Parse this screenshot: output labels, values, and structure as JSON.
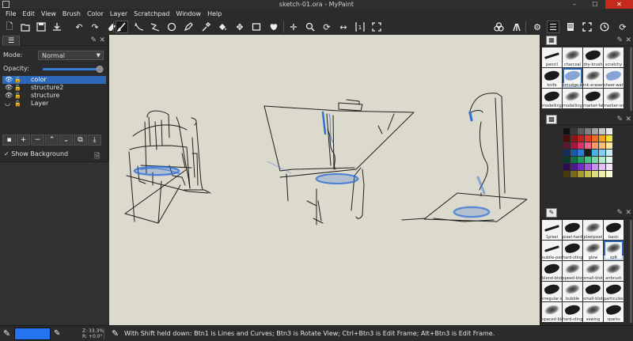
{
  "window": {
    "title": "sketch-01.ora - MyPaint",
    "minimize": "–",
    "maximize": "☐",
    "close": "✕"
  },
  "menu": [
    "File",
    "Edit",
    "View",
    "Brush",
    "Color",
    "Layer",
    "Scratchpad",
    "Window",
    "Help"
  ],
  "toolbar": {
    "icons": [
      "new-document-icon",
      "open-icon",
      "save-icon",
      "export-icon",
      "undo-icon",
      "redo-icon",
      "eraser-icon",
      "freehand-brush-icon",
      "lines-curves-icon",
      "connected-lines-icon",
      "ellipse-icon",
      "ink-pen-icon",
      "color-picker-icon",
      "fill-icon",
      "move-layer-icon",
      "frame-icon",
      "symmetry-icon",
      "pan-icon",
      "zoom-icon",
      "rotate-icon",
      "mirror-icon",
      "reset-view-icon",
      "fit-view-icon",
      "brush-settings-icon",
      "settings-gear-icon",
      "main-menu-icon",
      "scratchpad-icon",
      "fullscreen-icon",
      "history-icon",
      "more-icon"
    ]
  },
  "layers_panel": {
    "tab_icon": "layers-icon",
    "mode_label": "Mode:",
    "mode_value": "Normal",
    "opacity_label": "Opacity:",
    "opacity_value": 1.0,
    "layers": [
      {
        "name": "color",
        "selected": true
      },
      {
        "name": "structure2",
        "selected": false
      },
      {
        "name": "structure",
        "selected": false
      },
      {
        "name": "Layer",
        "selected": false
      }
    ],
    "buttons": [
      "layer-properties-icon",
      "add-layer-icon",
      "remove-layer-icon",
      "move-up-icon",
      "move-down-icon",
      "duplicate-layer-icon",
      "merge-down-icon"
    ],
    "show_background_label": "Show Background",
    "show_background_checked": true
  },
  "brush_group_1": {
    "brushes": [
      {
        "name": "pencil"
      },
      {
        "name": "charcoal"
      },
      {
        "name": "dry-brush"
      },
      {
        "name": "scratchy"
      },
      {
        "name": "knife"
      },
      {
        "name": "smudge-bleed"
      },
      {
        "name": "ink-eraser"
      },
      {
        "name": "sheer-watercolor"
      },
      {
        "name": "modelling"
      },
      {
        "name": "modelling2"
      },
      {
        "name": "marker-fat"
      },
      {
        "name": "marker-small"
      }
    ]
  },
  "palette": {
    "colors": [
      "#101010",
      "#3a3a3a",
      "#5d5d5d",
      "#808080",
      "#a3a3a3",
      "#c6c6c6",
      "#e9e9e9",
      "#4a0c0c",
      "#8a1a1a",
      "#c02222",
      "#e23b2a",
      "#f06d1e",
      "#f5a623",
      "#f7e23a",
      "#5a1a2e",
      "#a01a3c",
      "#e0306a",
      "#f06488",
      "#f79a6a",
      "#f6c07a",
      "#fbe89a",
      "#0f2e5a",
      "#1f5aa6",
      "#2d7be0",
      "#1c1c1c",
      "#4ab0e6",
      "#7fd0f2",
      "#c8ecfa",
      "#0c3a2a",
      "#16704a",
      "#22a063",
      "#46c085",
      "#7ad8a8",
      "#b2ecc8",
      "#e0f7ea",
      "#2a0c4a",
      "#4c1a8a",
      "#7a2ac6",
      "#a65ae0",
      "#c88ef0",
      "#e2bff6",
      "#f3e2fb",
      "#4a3a0c",
      "#7a6a1a",
      "#a69a2a",
      "#c6c04a",
      "#dcdc7a",
      "#ecf0a6",
      "#f9fbd6"
    ]
  },
  "brush_group_2": {
    "brushes": [
      {
        "name": "1pixel"
      },
      {
        "name": "pixel-hardness"
      },
      {
        "name": "pixelpixel"
      },
      {
        "name": "basic"
      },
      {
        "name": "subtle-pencil"
      },
      {
        "name": "hard-sting"
      },
      {
        "name": "glow"
      },
      {
        "name": "soft"
      },
      {
        "name": "blend-blob"
      },
      {
        "name": "speed-blot"
      },
      {
        "name": "small-blot"
      },
      {
        "name": "airbrush"
      },
      {
        "name": "irregular-ink"
      },
      {
        "name": "bubble"
      },
      {
        "name": "small-blot"
      },
      {
        "name": "particules-b"
      },
      {
        "name": "spaced-blot"
      },
      {
        "name": "hard-sting"
      },
      {
        "name": "sewing"
      },
      {
        "name": "sparks"
      }
    ]
  },
  "statusbar": {
    "current_color": "#2474f0",
    "zoom_text": "Z: 33.3%",
    "rotation_text": "R: +0.0°",
    "message": "With Shift held down:  Btn1 is Lines and Curves;  Btn3 is Rotate View;  Ctrl+Btn3 is Edit Frame;  Alt+Btn3 is Edit Frame."
  },
  "colors": {
    "selection": "#2c68b7",
    "canvas_background": "#dcdacd",
    "sketch_stroke": "#1e1e1e",
    "sketch_blue": "#2f6fd8"
  }
}
